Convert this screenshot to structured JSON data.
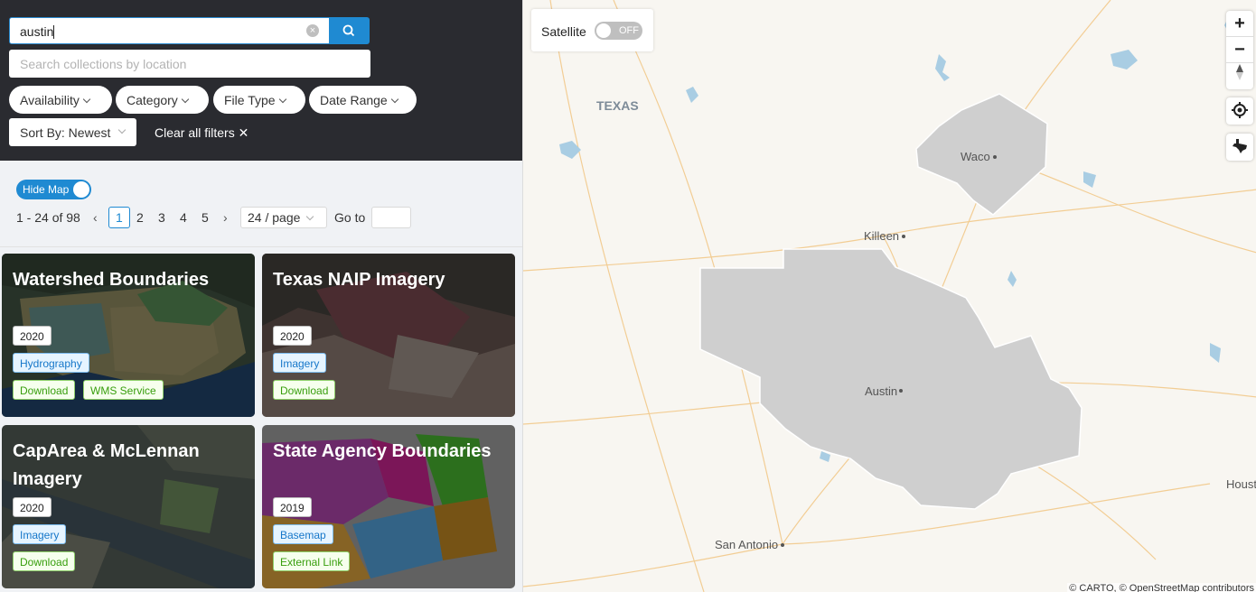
{
  "search": {
    "query": "austin",
    "location_placeholder": "Search collections by location"
  },
  "filters": {
    "pills": [
      "Availability",
      "Category",
      "File Type",
      "Date Range"
    ],
    "sort_label": "Sort By: Newest",
    "clear_label": "Clear all filters"
  },
  "map_toggle": {
    "label": "Hide Map"
  },
  "pagination": {
    "range_text": "1 - 24 of 98",
    "pages": [
      "1",
      "2",
      "3",
      "4",
      "5"
    ],
    "current": "1",
    "per_page": "24 / page",
    "goto_label": "Go to"
  },
  "cards": [
    {
      "title": "Watershed Boundaries",
      "year": "2020",
      "category": "Hydrography",
      "actions": [
        "Download",
        "WMS Service"
      ]
    },
    {
      "title": "Texas NAIP Imagery",
      "year": "2020",
      "category": "Imagery",
      "actions": [
        "Download"
      ]
    },
    {
      "title": "CapArea & McLennan Imagery",
      "year": "2020",
      "category": "Imagery",
      "actions": [
        "Download"
      ]
    },
    {
      "title": "State Agency Boundaries",
      "year": "2019",
      "category": "Basemap",
      "actions": [
        "External Link"
      ]
    }
  ],
  "map": {
    "satellite_label": "Satellite",
    "satellite_state": "OFF",
    "place_labels": [
      "TEXAS",
      "Waco",
      "Killeen",
      "Austin",
      "San Antonio",
      "Houst"
    ],
    "attribution": "© CARTO, © OpenStreetMap contributors",
    "colors": {
      "water": "#a9cde3",
      "roads": "#f2c98b",
      "coverage": "#cfcfcf"
    }
  }
}
